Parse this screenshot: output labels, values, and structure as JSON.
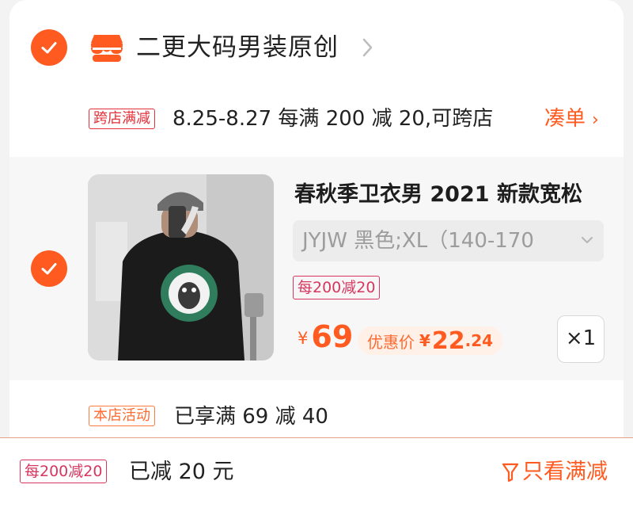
{
  "colors": {
    "accent": "#ff5a1f",
    "cross_store_tag": "#e6303a",
    "discount_tag": "#d7375e",
    "coupon_bg": "#fff0e8"
  },
  "shop": {
    "name": "二更大码男装原创",
    "icon": "shop-icon",
    "checked": true
  },
  "cross_store_promo": {
    "tag": "跨店满减",
    "text": "8.25-8.27 每满 200 减 20,可跨店",
    "action": "凑单"
  },
  "item": {
    "checked": true,
    "title": "春秋季卫衣男 2021 新款宽松",
    "sku": "JYJW 黑色;XL（140-170",
    "discount_tag": "每200减20",
    "currency": "¥",
    "price": "69",
    "coupon_label": "优惠价",
    "coupon_currency": "¥",
    "coupon_price_int": "22",
    "coupon_price_dec": ".24",
    "quantity": "×1"
  },
  "store_activity": {
    "tag": "本店活动",
    "text": "已享满 69 减 40"
  },
  "bottom_bar": {
    "tag": "每200减20",
    "saved_text": "已减 20 元",
    "filter_label": "只看满减"
  }
}
